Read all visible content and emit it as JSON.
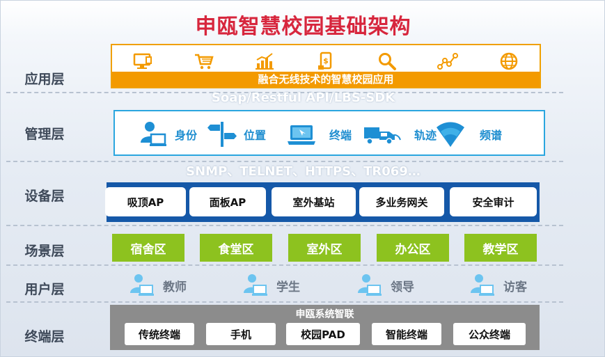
{
  "title": "申瓯智慧校园基础架构",
  "layers": {
    "application": "应用层",
    "management": "管理层",
    "device": "设备层",
    "scene": "场景层",
    "user": "用户层",
    "terminal": "终端层"
  },
  "application": {
    "icons": [
      "monitor-icon",
      "shopping-cart-icon",
      "bar-chart-icon",
      "mobile-payment-icon",
      "search-icon",
      "network-nodes-icon",
      "globe-icon"
    ],
    "banner": "融合无线技术的智慧校园应用"
  },
  "protocols": {
    "api": "Soap/Restful API/LBS-SDK",
    "device": "SNMP、TELNET、HTTPS、TR069…"
  },
  "management": {
    "items": [
      {
        "label": "身份",
        "icon": "identity-user-icon"
      },
      {
        "label": "位置",
        "icon": "location-signpost-icon"
      },
      {
        "label": "终端",
        "icon": "laptop-icon"
      },
      {
        "label": "轨迹",
        "icon": "vehicle-track-icon"
      },
      {
        "label": "频谱",
        "icon": "wifi-spectrum-icon"
      }
    ]
  },
  "devices": [
    "吸顶AP",
    "面板AP",
    "室外基站",
    "多业务网关",
    "安全审计"
  ],
  "scenes": [
    "宿舍区",
    "食堂区",
    "室外区",
    "办公区",
    "教学区"
  ],
  "users": [
    "教师",
    "学生",
    "领导",
    "访客"
  ],
  "terminal": {
    "title": "申瓯系统智联",
    "items": [
      "传统终端",
      "手机",
      "校园PAD",
      "智能终端",
      "公众终端"
    ]
  },
  "colors": {
    "title": "#d7263d",
    "app_border": "#f0a000",
    "app_banner": "#f39a00",
    "mgmt_border": "#2aa6df",
    "mgmt_text": "#1f8ed0",
    "device_band": "#1558a8",
    "scene_green": "#8dc21f",
    "terminal_gray": "#8c8c8c",
    "icon_blue": "#1e8fd4"
  }
}
